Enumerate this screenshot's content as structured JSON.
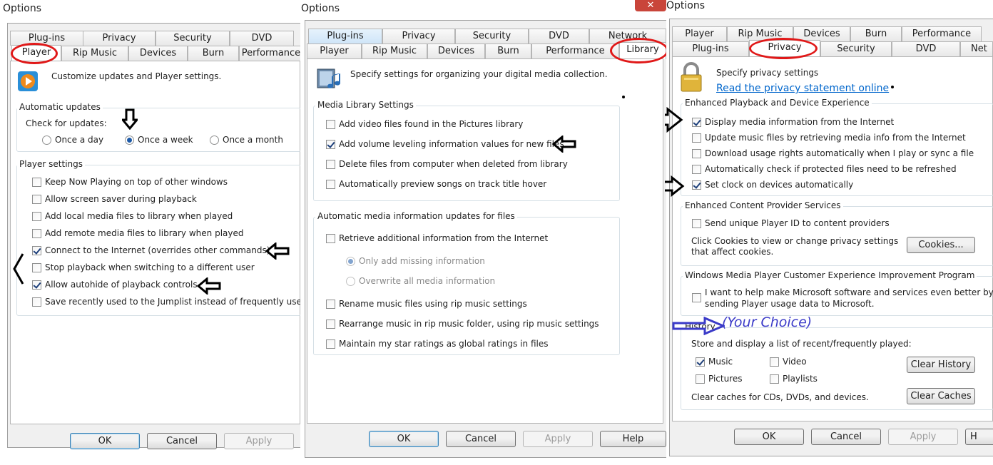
{
  "colors": {
    "annotation_red": "#e01818",
    "annotation_blue": "#3a3ac8",
    "link_blue": "#0066cc"
  },
  "dialog1": {
    "title": "Options",
    "tabs_row1": [
      "Plug-ins",
      "Privacy",
      "Security",
      "DVD"
    ],
    "tabs_row2": [
      "Player",
      "Rip Music",
      "Devices",
      "Burn",
      "Performance"
    ],
    "icon": "wmp-player-icon",
    "description": "Customize updates and Player settings.",
    "updates_group": "Automatic updates",
    "check_label": "Check for updates:",
    "radios": [
      {
        "label": "Once a day",
        "selected": false
      },
      {
        "label": "Once a week",
        "selected": true
      },
      {
        "label": "Once a month",
        "selected": false
      }
    ],
    "settings_group": "Player settings",
    "checkboxes": [
      {
        "label": "Keep Now Playing on top of other windows",
        "checked": false
      },
      {
        "label": "Allow screen saver during playback",
        "checked": false
      },
      {
        "label": "Add local media files to library when played",
        "checked": false
      },
      {
        "label": "Add remote media files to library when played",
        "checked": false
      },
      {
        "label": "Connect to the Internet (overrides other commands)",
        "checked": true
      },
      {
        "label": "Stop playback when switching to a different user",
        "checked": false
      },
      {
        "label": "Allow autohide of playback controls",
        "checked": true
      },
      {
        "label": "Save recently used to the Jumplist instead of frequently used",
        "checked": false
      }
    ],
    "buttons": {
      "ok": "OK",
      "cancel": "Cancel",
      "apply": "Apply"
    }
  },
  "dialog2": {
    "title": "Options",
    "tabs_row1": [
      "Plug-ins",
      "Privacy",
      "Security",
      "DVD",
      "Network"
    ],
    "tabs_row2": [
      "Player",
      "Rip Music",
      "Devices",
      "Burn",
      "Performance",
      "Library"
    ],
    "icon": "media-library-icon",
    "description": "Specify settings for organizing your digital media collection.",
    "library_group": "Media Library Settings",
    "library_checkboxes": [
      {
        "label": "Add video files found in the Pictures library",
        "checked": false
      },
      {
        "label": "Add volume leveling information values for new files",
        "checked": true
      },
      {
        "label": "Delete files from computer when deleted from library",
        "checked": false
      },
      {
        "label": "Automatically preview songs on track title hover",
        "checked": false
      }
    ],
    "auto_group": "Automatic media information updates for files",
    "retrieve_label": "Retrieve additional information from the Internet",
    "retrieve_radios": [
      {
        "label": "Only add missing information",
        "selected": true
      },
      {
        "label": "Overwrite all media information",
        "selected": false
      }
    ],
    "more_checkboxes": [
      {
        "label": "Rename music files using rip music settings",
        "checked": false
      },
      {
        "label": "Rearrange music in rip music folder, using rip music settings",
        "checked": false
      },
      {
        "label": "Maintain my star ratings as global ratings in files",
        "checked": false
      }
    ],
    "buttons": {
      "ok": "OK",
      "cancel": "Cancel",
      "apply": "Apply",
      "help": "Help"
    }
  },
  "dialog3": {
    "title": "Options",
    "tabs_row1": [
      "Player",
      "Rip Music",
      "Devices",
      "Burn",
      "Performance"
    ],
    "tabs_row2": [
      "Plug-ins",
      "Privacy",
      "Security",
      "DVD",
      "Net"
    ],
    "icon": "padlock-icon",
    "description": "Specify privacy settings",
    "privacy_link": "Read the privacy statement online",
    "enhanced_group": "Enhanced Playback and Device Experience",
    "enhanced_checkboxes": [
      {
        "label": "Display media information from the Internet",
        "checked": true
      },
      {
        "label": "Update music files by retrieving media info from the Internet",
        "checked": false
      },
      {
        "label": "Download usage rights automatically when I play or sync a file",
        "checked": false
      },
      {
        "label": "Automatically check if protected files need to be refreshed",
        "checked": false
      },
      {
        "label": "Set clock on devices automatically",
        "checked": true
      }
    ],
    "provider_group": "Enhanced Content Provider Services",
    "provider_checkbox": {
      "label": "Send unique Player ID to content providers",
      "checked": false
    },
    "cookies_text_1": "Click Cookies to view or change privacy settings",
    "cookies_text_2": "that affect cookies.",
    "cookies_button": "Cookies...",
    "ceip_group": "Windows Media Player Customer Experience Improvement Program",
    "ceip_text_1": "I want to help make Microsoft software and services even better by",
    "ceip_text_2": "sending Player usage data to Microsoft.",
    "ceip_checked": false,
    "history_group": "History",
    "history_note": "(Your Choice)",
    "history_text": "Store and display a list of recent/frequently played:",
    "history_checkboxes": [
      {
        "label": "Music",
        "checked": true
      },
      {
        "label": "Video",
        "checked": false
      },
      {
        "label": "Pictures",
        "checked": false
      },
      {
        "label": "Playlists",
        "checked": false
      }
    ],
    "clear_history": "Clear History",
    "clear_caches_text": "Clear caches for CDs, DVDs, and devices.",
    "clear_caches": "Clear Caches",
    "buttons": {
      "ok": "OK",
      "cancel": "Cancel",
      "apply": "Apply",
      "help": "H"
    }
  }
}
